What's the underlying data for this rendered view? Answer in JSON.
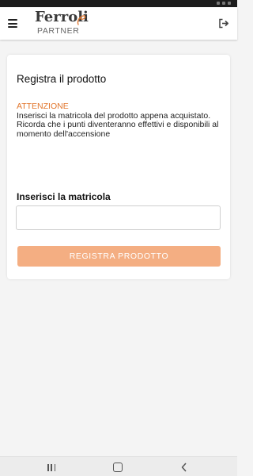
{
  "header": {
    "logo_brand": "Ferroli",
    "logo_sub": "PARTNER",
    "menu_icon": "hamburger-menu-icon",
    "logout_icon": "logout-icon"
  },
  "card": {
    "title": "Registra il prodotto",
    "warning_title": "ATTENZIONE",
    "warning_line1": "Inserisci la matricola del prodotto appena acquistato.",
    "warning_line2": "Ricorda che i punti diventeranno effettivi e disponibili al momento dell'accensione",
    "field_label": "Inserisci la matricola",
    "field_value": "",
    "field_placeholder": "",
    "button_label": "REGISTRA PRODOTTO"
  },
  "nav": {
    "recent_icon": "recent-apps-icon",
    "home_icon": "home-icon",
    "back_icon": "back-icon"
  },
  "colors": {
    "accent": "#e2762c",
    "button_bg": "#f4ae82",
    "background": "#f4f4f4"
  }
}
